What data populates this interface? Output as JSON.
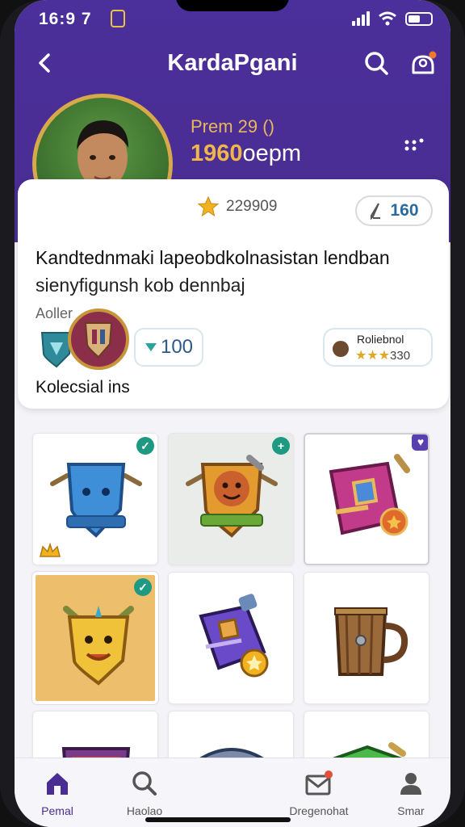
{
  "status": {
    "time": "16:9 7"
  },
  "header": {
    "title": "KardaPgani"
  },
  "profile": {
    "rank_label": "Prem 29 ()",
    "rank_score_bold": "1960",
    "rank_score_suffix": "oepm",
    "coins": "229909",
    "stat_value": "160",
    "bio_line1": "Kandtednmaki lapeobdkolnasistan lendban",
    "bio_line2": "sienyfigunsh kob dennbaj",
    "sub_label": "Aoller",
    "count_value": "100",
    "rank_card_title": "Roliebnol",
    "rank_card_value": "330",
    "collection_label": "Kolecsial ins"
  },
  "collection": {
    "items": [
      {
        "icon": "blue-shield-emblem-icon",
        "badge": "check"
      },
      {
        "icon": "gold-shield-emblem-icon",
        "badge": "plus"
      },
      {
        "icon": "pink-gem-emblem-icon",
        "badge": "heart"
      },
      {
        "icon": "gold-mask-emblem-icon",
        "badge": "check"
      },
      {
        "icon": "purple-bottle-emblem-icon",
        "badge": ""
      },
      {
        "icon": "wooden-mug-icon",
        "badge": ""
      },
      {
        "icon": "red-crest-emblem-icon",
        "badge": ""
      },
      {
        "icon": "blue-helmet-emblem-icon",
        "badge": ""
      },
      {
        "icon": "green-crystal-emblem-icon",
        "badge": ""
      }
    ]
  },
  "tabbar": {
    "tabs": [
      {
        "label": "Pemal",
        "icon": "home-icon",
        "active": true
      },
      {
        "label": "Haolao",
        "icon": "search-icon",
        "active": false
      },
      {
        "label": "Dregenohat",
        "icon": "mail-icon",
        "active": false
      },
      {
        "label": "Smar",
        "icon": "profile-icon",
        "active": false
      }
    ]
  },
  "colors": {
    "header": "#4a2d92",
    "accent_gold": "#e8b85a",
    "teal": "#1f9a82"
  }
}
